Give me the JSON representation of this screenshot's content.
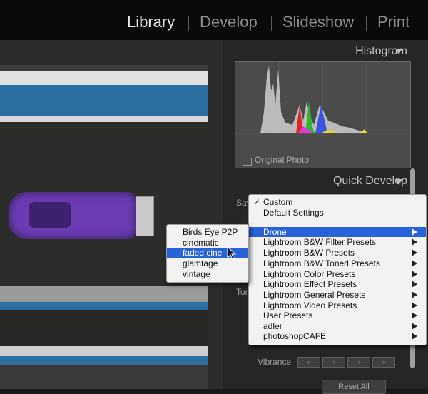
{
  "modules": [
    "Library",
    "Develop",
    "Slideshow",
    "Print"
  ],
  "active_module": "Library",
  "panel": {
    "histogram_title": "Histogram",
    "original_photo_label": "Original Photo",
    "quick_develop_title": "Quick Develop",
    "saved_preset_label": "Sav",
    "tone_label": "Ton",
    "vibrance_label": "Vibrance",
    "vibrance_buttons": [
      "«",
      "‹",
      "›",
      "»"
    ],
    "reset_all_label": "Reset All"
  },
  "preset_menu": {
    "checked_mark": "✓",
    "items": [
      {
        "label": "Custom",
        "checked": true
      },
      {
        "label": "Default Settings"
      },
      {
        "label": "Drone",
        "submenu": true,
        "highlighted": true
      },
      {
        "label": "Lightroom B&W Filter Presets",
        "submenu": true
      },
      {
        "label": "Lightroom B&W Presets",
        "submenu": true
      },
      {
        "label": "Lightroom B&W Toned Presets",
        "submenu": true
      },
      {
        "label": "Lightroom Color Presets",
        "submenu": true
      },
      {
        "label": "Lightroom Effect Presets",
        "submenu": true
      },
      {
        "label": "Lightroom General Presets",
        "submenu": true
      },
      {
        "label": "Lightroom Video Presets",
        "submenu": true
      },
      {
        "label": "User Presets",
        "submenu": true
      },
      {
        "label": "adler",
        "submenu": true
      },
      {
        "label": "photoshopCAFE",
        "submenu": true
      }
    ]
  },
  "drone_submenu": {
    "items": [
      {
        "label": "Birds Eye P2P"
      },
      {
        "label": "cinematic"
      },
      {
        "label": "faded cine",
        "highlighted": true
      },
      {
        "label": "glamtage"
      },
      {
        "label": "vintage"
      }
    ]
  },
  "colors": {
    "menu_highlight": "#2a62d8",
    "panel_bg": "#262626",
    "car": "#6b3db4"
  }
}
